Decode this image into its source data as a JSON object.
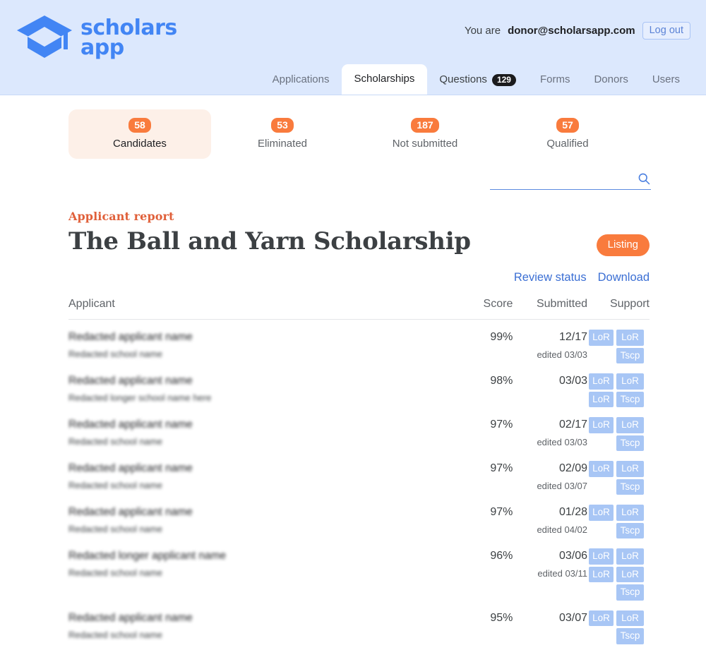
{
  "header": {
    "logo_text_line1": "scholars",
    "logo_text_line2": "app",
    "logo_icon": "graduation-cap-icon",
    "you_are_label": "You are",
    "user_email": "donor@scholarsapp.com",
    "logout_label": "Log out",
    "brand_color": "#4285f4",
    "background_color": "#dce8fd",
    "nav": [
      {
        "label": "Applications",
        "active": false,
        "badge": null
      },
      {
        "label": "Scholarships",
        "active": true,
        "badge": null
      },
      {
        "label": "Questions",
        "active": false,
        "badge": "129"
      },
      {
        "label": "Forms",
        "active": false,
        "badge": null
      },
      {
        "label": "Donors",
        "active": false,
        "badge": null
      },
      {
        "label": "Users",
        "active": false,
        "badge": null
      }
    ]
  },
  "stats": [
    {
      "count": "58",
      "label": "Candidates",
      "active": true
    },
    {
      "count": "53",
      "label": "Eliminated",
      "active": false
    },
    {
      "count": "187",
      "label": "Not submitted",
      "active": false
    },
    {
      "count": "57",
      "label": "Qualified",
      "active": false
    }
  ],
  "search": {
    "value": "",
    "placeholder": "",
    "icon": "search-icon",
    "accent_color": "#5c8ae0"
  },
  "report": {
    "kicker": "Applicant report",
    "kicker_color": "#e0603a",
    "title": "The Ball and Yarn Scholarship",
    "listing_badge": "Listing",
    "listing_badge_color": "#f97b3d",
    "actions": [
      {
        "label": "Review status"
      },
      {
        "label": "Download"
      }
    ]
  },
  "table": {
    "columns": {
      "applicant": "Applicant",
      "score": "Score",
      "submitted": "Submitted",
      "support": "Support"
    },
    "rows": [
      {
        "name": "Redacted applicant name",
        "school": "Redacted school name",
        "score": "99%",
        "submitted": "12/17",
        "edited": "edited 03/03",
        "support_col1": [
          "LoR"
        ],
        "support_col2": [
          "LoR",
          "Tscp"
        ]
      },
      {
        "name": "Redacted applicant name",
        "school": "Redacted longer school name here",
        "score": "98%",
        "submitted": "03/03",
        "edited": "",
        "support_col1": [
          "LoR",
          "LoR"
        ],
        "support_col2": [
          "LoR",
          "Tscp"
        ]
      },
      {
        "name": "Redacted applicant name",
        "school": "Redacted school name",
        "score": "97%",
        "submitted": "02/17",
        "edited": "edited 03/03",
        "support_col1": [
          "LoR"
        ],
        "support_col2": [
          "LoR",
          "Tscp"
        ]
      },
      {
        "name": "Redacted applicant name",
        "school": "Redacted school name",
        "score": "97%",
        "submitted": "02/09",
        "edited": "edited 03/07",
        "support_col1": [
          "LoR"
        ],
        "support_col2": [
          "LoR",
          "Tscp"
        ]
      },
      {
        "name": "Redacted applicant name",
        "school": "Redacted school name",
        "score": "97%",
        "submitted": "01/28",
        "edited": "edited 04/02",
        "support_col1": [
          "LoR"
        ],
        "support_col2": [
          "LoR",
          "Tscp"
        ]
      },
      {
        "name": "Redacted longer applicant name",
        "school": "Redacted school name",
        "score": "96%",
        "submitted": "03/06",
        "edited": "edited 03/11",
        "support_col1": [
          "LoR",
          "LoR"
        ],
        "support_col2": [
          "LoR",
          "LoR",
          "Tscp"
        ]
      },
      {
        "name": "Redacted applicant name",
        "school": "Redacted school name",
        "score": "95%",
        "submitted": "03/07",
        "edited": "",
        "support_col1": [
          "LoR"
        ],
        "support_col2": [
          "LoR",
          "Tscp"
        ]
      }
    ]
  }
}
